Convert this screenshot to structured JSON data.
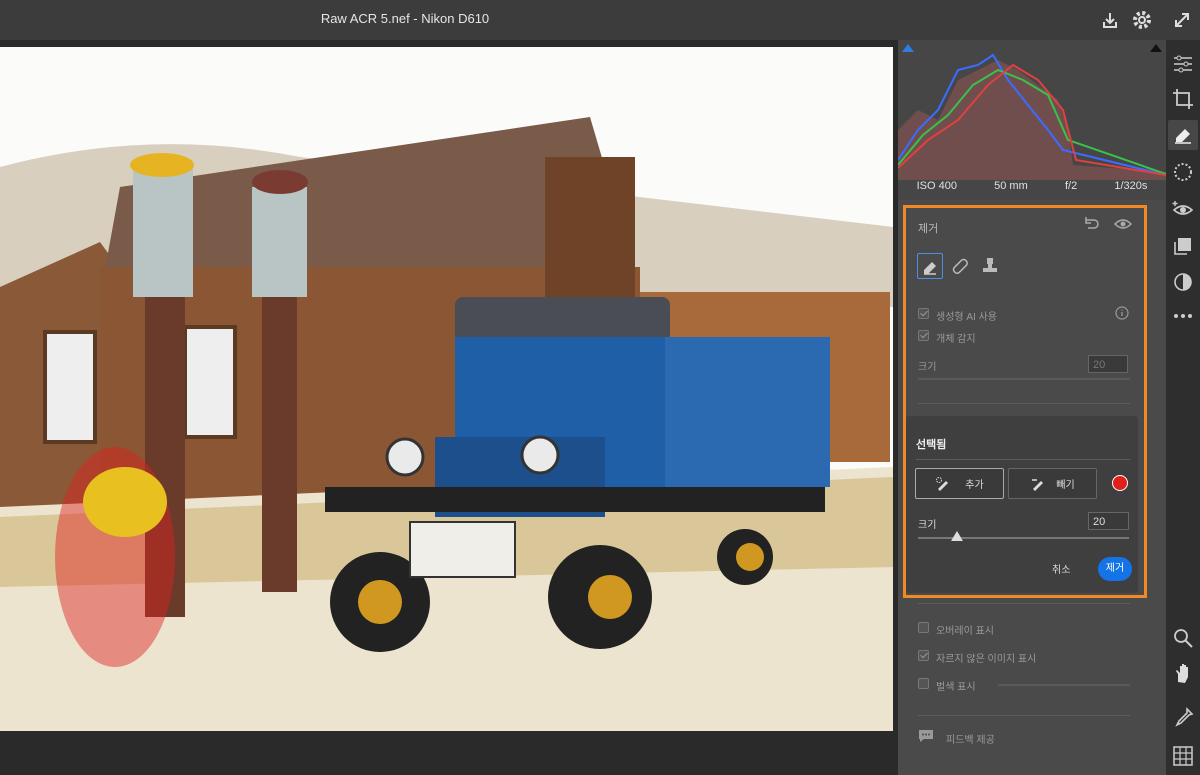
{
  "window": {
    "title": "Raw ACR 5.nef  -  Nikon D610"
  },
  "histogram": {
    "iso": "ISO 400",
    "focal": "50 mm",
    "aperture": "f/2",
    "shutter": "1/320s"
  },
  "remove_panel": {
    "header": "제거",
    "tools": [
      "eraser-icon",
      "bandage-icon",
      "stamp-icon"
    ],
    "gen_ai_label": "생성형 AI 사용",
    "gen_ai_checked": true,
    "object_detect_label": "개체 감지",
    "object_detect_checked": true,
    "size_label": "크기",
    "size_value": "20",
    "selection": {
      "header": "선택됨",
      "add_label": "추가",
      "subtract_label": "빼기",
      "size_label": "크기",
      "size_value": "20",
      "cancel_label": "취소",
      "remove_label": "제거",
      "color": "#e0201c"
    },
    "overlay_label": "오버레이 표시",
    "overlay_checked": false,
    "uncropped_label": "자르지 않은 이미지 표시",
    "uncropped_checked": true,
    "mask_label": "벌색 표시",
    "mask_checked": false,
    "feedback_label": "피드백 제공"
  },
  "colors": {
    "accent": "#1473e6",
    "outline": "#f08a24",
    "panel": "#4a4a4a"
  }
}
